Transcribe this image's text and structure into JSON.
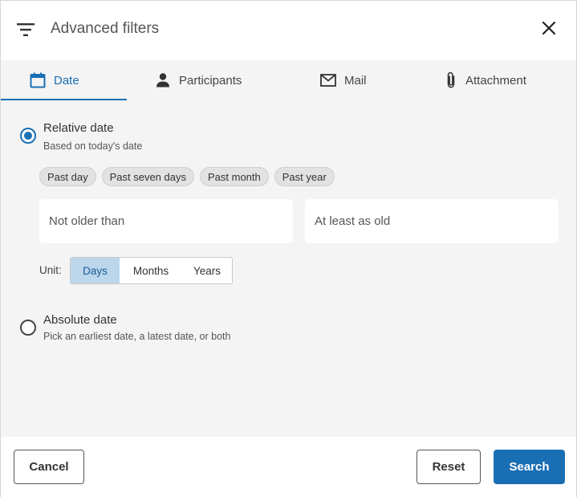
{
  "header": {
    "title": "Advanced filters"
  },
  "tabs": [
    {
      "label": "Date",
      "icon": "calendar-icon",
      "active": true
    },
    {
      "label": "Participants",
      "icon": "person-icon",
      "active": false
    },
    {
      "label": "Mail",
      "icon": "mail-icon",
      "active": false
    },
    {
      "label": "Attachment",
      "icon": "paperclip-icon",
      "active": false
    }
  ],
  "relative": {
    "label": "Relative date",
    "sub": "Based on today's date",
    "checked": true,
    "chips": [
      "Past day",
      "Past seven days",
      "Past month",
      "Past year"
    ],
    "min_placeholder": "Not older than",
    "max_placeholder": "At least as old",
    "unit_label": "Unit:",
    "units": [
      "Days",
      "Months",
      "Years"
    ],
    "selected_unit": "Days"
  },
  "absolute": {
    "label": "Absolute date",
    "sub": "Pick an earliest date, a latest date, or both",
    "checked": false
  },
  "footer": {
    "cancel": "Cancel",
    "reset": "Reset",
    "search": "Search"
  },
  "colors": {
    "accent": "#1a6fb4",
    "panel_bg": "#f4f4f4",
    "selected_unit_bg": "#bcd6ec"
  }
}
